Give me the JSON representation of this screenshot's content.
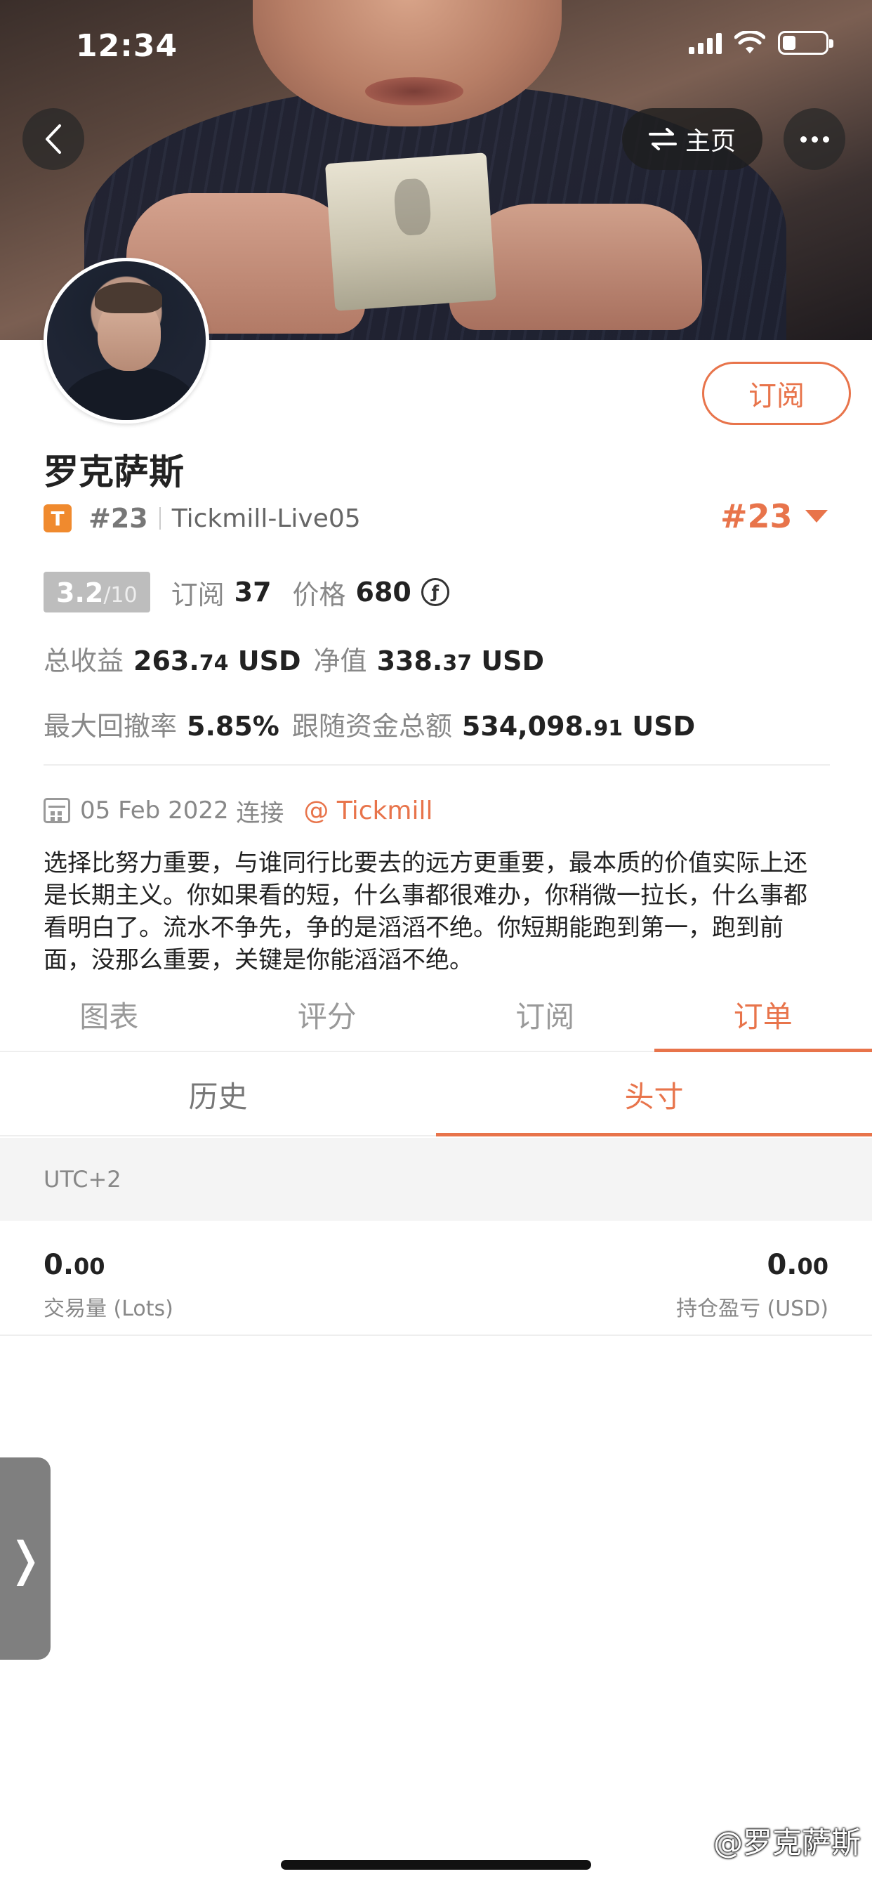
{
  "status_bar": {
    "time": "12:34"
  },
  "header": {
    "home_label": "主页"
  },
  "profile": {
    "name": "罗克萨斯",
    "badge_letter": "T",
    "rank_small": "#23",
    "server": "Tickmill-Live05",
    "rank_large": "#23",
    "subscribe_label": "订阅"
  },
  "stats": {
    "score": "3.2",
    "score_denominator": "/10",
    "subscribe_label": "订阅",
    "subscribe_count": "37",
    "price_label": "价格",
    "price_value": "680",
    "coin_symbol": "ƒ",
    "total_profit_label": "总收益",
    "total_profit_int": "263.",
    "total_profit_dec": "74",
    "total_profit_unit": "USD",
    "net_value_label": "净值",
    "net_value_int": "338.",
    "net_value_dec": "37",
    "net_value_unit": "USD",
    "max_drawdown_label": "最大回撤率",
    "max_drawdown_value": "5.85%",
    "follow_funds_label": "跟随资金总额",
    "follow_funds_int": "534,098.",
    "follow_funds_dec": "91",
    "follow_funds_unit": "USD"
  },
  "connection": {
    "date": "05 Feb 2022",
    "connect_label": "连接",
    "broker": "@ Tickmill"
  },
  "bio": "选择比努力重要，与谁同行比要去的远方更重要，最本质的价值实际上还是长期主义。你如果看的短，什么事都很难办，你稍微一拉长，什么事都看明白了。流水不争先，争的是滔滔不绝。你短期能跑到第一，跑到前面，没那么重要，关键是你能滔滔不绝。",
  "tabs": [
    {
      "label": "图表",
      "active": false
    },
    {
      "label": "评分",
      "active": false
    },
    {
      "label": "订阅",
      "active": false
    },
    {
      "label": "订单",
      "active": true
    }
  ],
  "subtabs": [
    {
      "label": "历史",
      "active": false
    },
    {
      "label": "头寸",
      "active": true
    }
  ],
  "timezone": "UTC+2",
  "summary": {
    "volume_int": "0.",
    "volume_dec": "00",
    "volume_label": "交易量 (Lots)",
    "pnl_int": "0.",
    "pnl_dec": "00",
    "pnl_label": "持仓盈亏 (USD)"
  },
  "side_handle_glyph": "❭",
  "watermark": "@罗克萨斯",
  "colors": {
    "accent": "#e8744b",
    "badge": "#f08a2e",
    "score_bg": "#bdbdbd"
  }
}
